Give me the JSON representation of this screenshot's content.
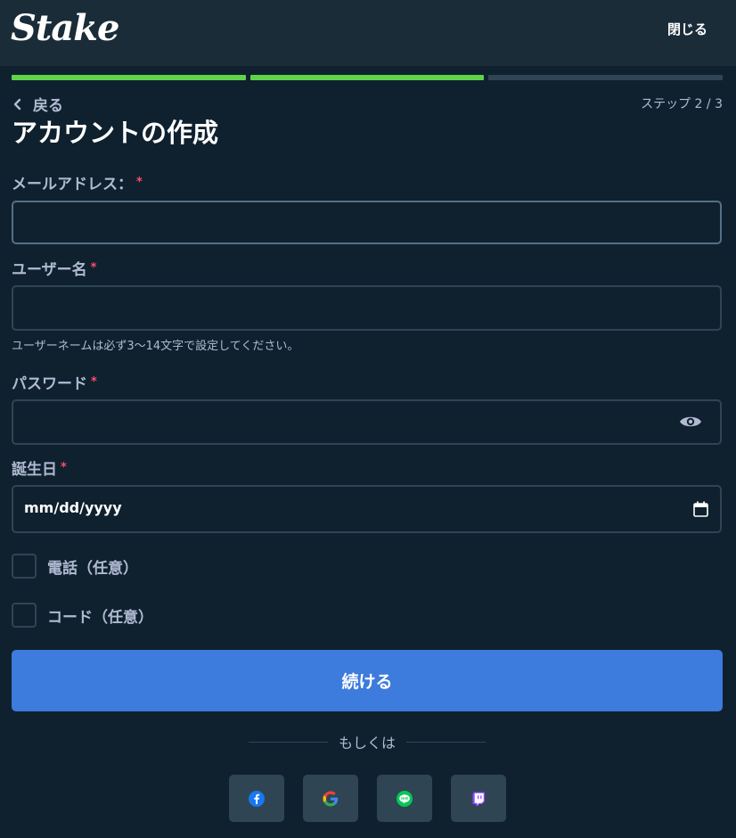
{
  "header": {
    "logo": "Stake",
    "close_label": "閉じる"
  },
  "progress": {
    "current_step": 2,
    "total_steps": 3
  },
  "nav": {
    "back_label": "戻る",
    "step_label": "ステップ 2 / 3"
  },
  "page": {
    "title": "アカウントの作成"
  },
  "form": {
    "email_label": "メールアドレス：",
    "email_value": "",
    "username_label": "ユーザー名",
    "username_value": "",
    "username_hint": "ユーザーネームは必ず3〜14文字で設定してください。",
    "password_label": "パスワード",
    "password_value": "",
    "dob_label": "誕生日",
    "dob_placeholder": "mm/dd/yyyy",
    "required_mark": "*",
    "phone_checkbox_label": "電話（任意）",
    "code_checkbox_label": "コード（任意）",
    "continue_label": "続ける"
  },
  "divider": {
    "or_label": "もしくは"
  },
  "social": [
    {
      "name": "facebook",
      "icon": "facebook-icon",
      "color": "#1877f2"
    },
    {
      "name": "google",
      "icon": "google-icon",
      "color": "#4285f4"
    },
    {
      "name": "line",
      "icon": "line-icon",
      "color": "#06c755"
    },
    {
      "name": "twitch",
      "icon": "twitch-icon",
      "color": "#9146ff"
    }
  ],
  "colors": {
    "background": "#0f212e",
    "header": "#1a2c38",
    "progress_done": "#5fd34a",
    "progress_todo": "#2f4553",
    "primary_button": "#3d7bdc",
    "required": "#ff4d6a"
  }
}
